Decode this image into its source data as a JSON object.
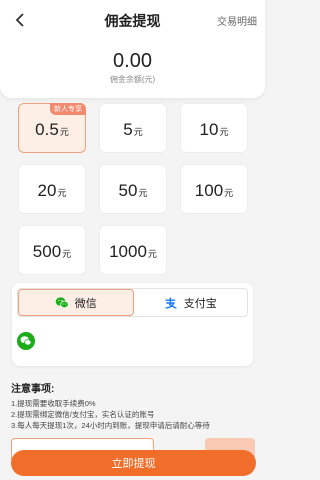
{
  "header": {
    "title": "佣金提现",
    "detail_link": "交易明细"
  },
  "balance": {
    "amount": "0.00",
    "label": "佣金余额(元)"
  },
  "amounts": {
    "unit": "元",
    "badge": "新人专享",
    "options": [
      "0.5",
      "5",
      "10",
      "20",
      "50",
      "100",
      "500",
      "1000"
    ],
    "selected_index": 0
  },
  "payment": {
    "tabs": [
      {
        "label": "微信",
        "icon": "wechat-icon"
      },
      {
        "label": "支付宝",
        "icon": "alipay-icon"
      }
    ],
    "active_index": 0
  },
  "notes": {
    "title": "注意事项:",
    "lines": [
      "1.提现需要收取手续费0%",
      "2.提现需绑定微信/支付宝，实名认证的账号",
      "3.每人每天提现1次，24小时内到账，提现申请后请耐心等待"
    ]
  },
  "submit_label": "立即提现",
  "colors": {
    "accent": "#f06d2a",
    "selected_bg": "#fdeee6",
    "badge": "#f28a6f",
    "wechat": "#1aad19",
    "alipay": "#1677ff"
  }
}
